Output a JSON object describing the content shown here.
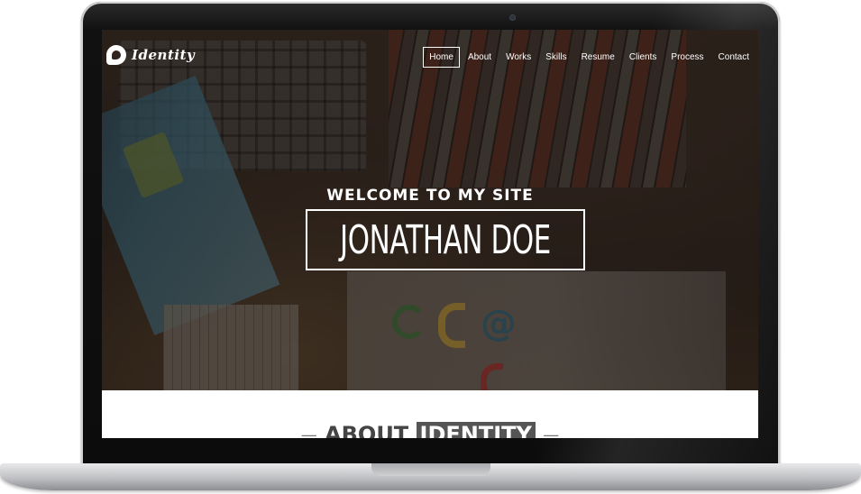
{
  "site": {
    "brand": "Identity",
    "nav": [
      {
        "label": "Home",
        "active": true
      },
      {
        "label": "About",
        "active": false
      },
      {
        "label": "Works",
        "active": false
      },
      {
        "label": "Skills",
        "active": false
      },
      {
        "label": "Resume",
        "active": false
      },
      {
        "label": "Clients",
        "active": false
      },
      {
        "label": "Process",
        "active": false
      },
      {
        "label": "Contact",
        "active": false
      }
    ],
    "hero": {
      "welcome": "WELCOME TO MY SITE",
      "name": "JONATHAN DOE"
    },
    "about": {
      "dash_left": "—",
      "word1": "ABOUT",
      "word2": "IDENTITY",
      "dash_right": "—"
    }
  },
  "colors": {
    "frame": "#111111",
    "hero_overlay": "#19120e",
    "text_light": "#ffffff",
    "about_bg": "#ffffff",
    "about_highlight": "#555555"
  },
  "icons": {
    "brand": "identity-logo-icon",
    "camera": "camera-icon"
  }
}
